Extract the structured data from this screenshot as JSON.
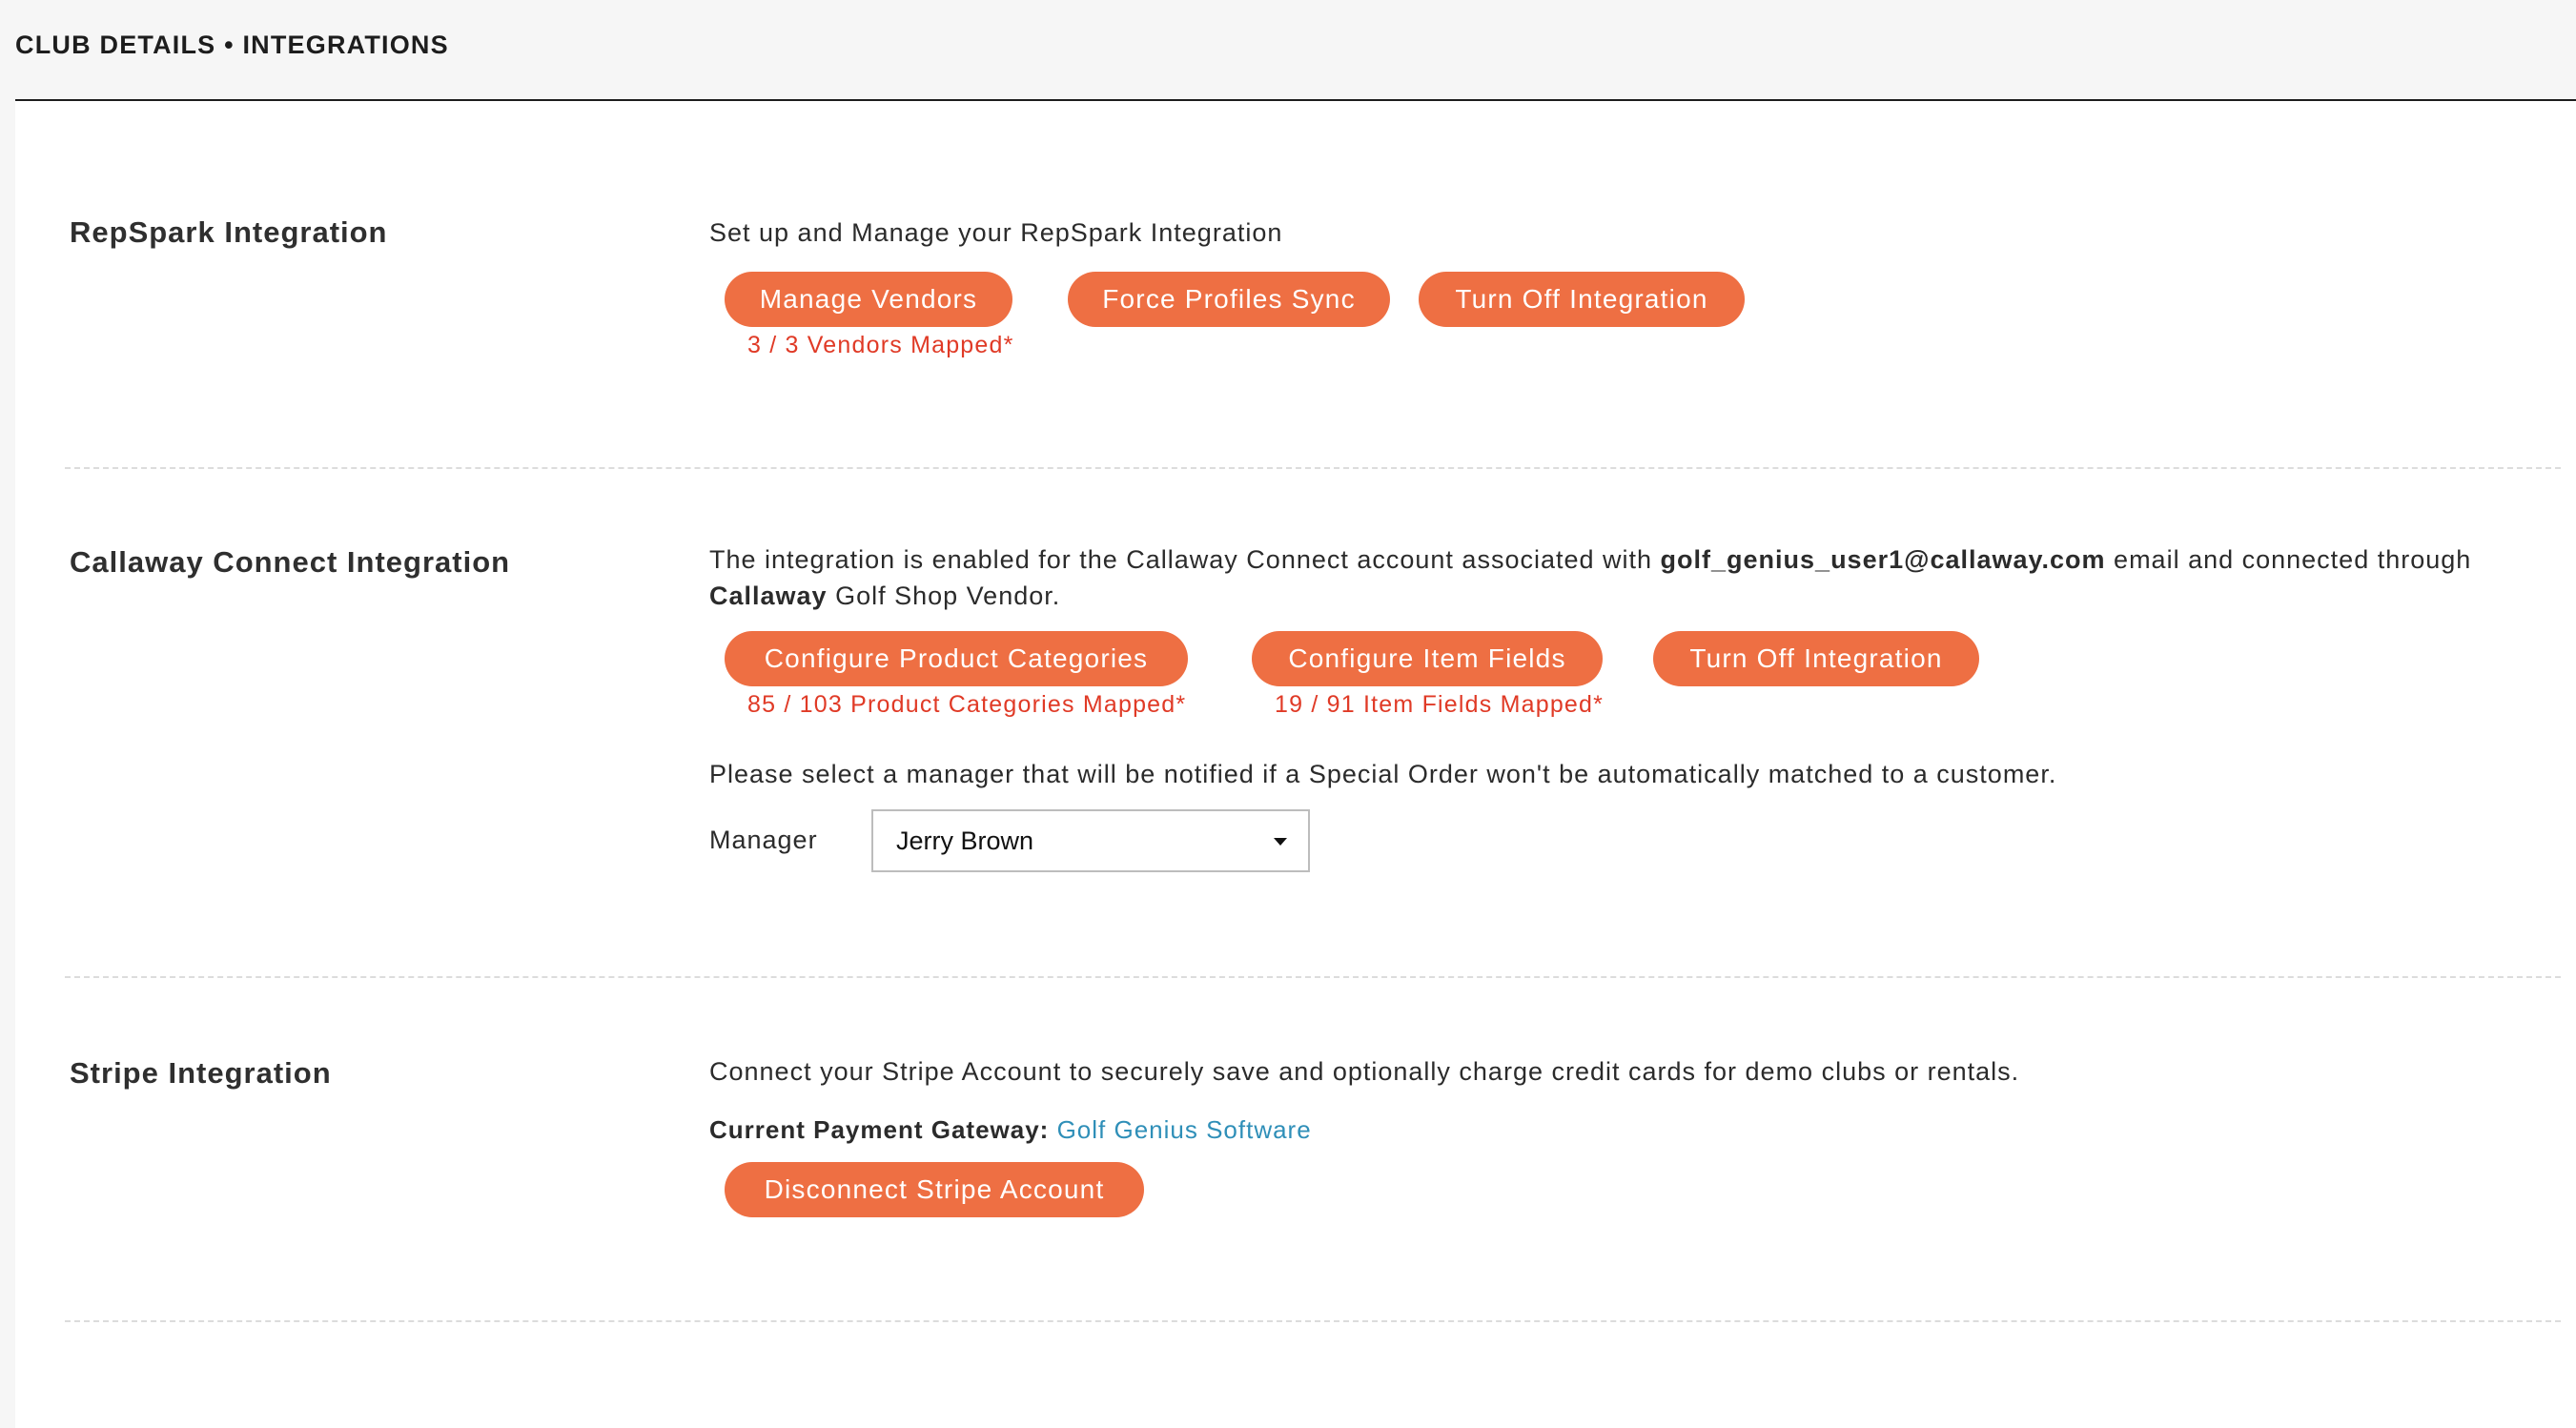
{
  "header": {
    "title": "CLUB DETAILS • INTEGRATIONS"
  },
  "repspark": {
    "title": "RepSpark Integration",
    "description": "Set up and Manage your RepSpark Integration",
    "buttons": {
      "manage_vendors": "Manage Vendors",
      "force_sync": "Force Profiles Sync",
      "turn_off": "Turn Off Integration"
    },
    "vendors_note": "3 / 3 Vendors Mapped*"
  },
  "callaway": {
    "title": "Callaway Connect Integration",
    "description_prefix": "The integration is enabled for the Callaway Connect account associated with ",
    "email": "golf_genius_user1@callaway.com",
    "description_middle": " email and connected through",
    "vendor_name": "Callaway",
    "description_suffix": " Golf Shop Vendor.",
    "buttons": {
      "configure_categories": "Configure Product Categories",
      "configure_fields": "Configure Item Fields",
      "turn_off": "Turn Off Integration"
    },
    "categories_note": "85 / 103 Product Categories Mapped*",
    "fields_note": "19 / 91 Item Fields Mapped*",
    "manager_prompt": "Please select a manager that will be notified if a Special Order won't be automatically matched to a customer.",
    "manager_label": "Manager",
    "manager_value": "Jerry Brown"
  },
  "stripe": {
    "title": "Stripe Integration",
    "description": "Connect your Stripe Account to securely save and optionally charge credit cards for demo clubs or rentals.",
    "gateway_label": "Current Payment Gateway:",
    "gateway_value": "Golf Genius Software",
    "disconnect_button": "Disconnect Stripe Account"
  },
  "colors": {
    "accent": "#ee6f43",
    "note_red": "#e03a26",
    "link_blue": "#2f8fb8"
  },
  "icons": {
    "dropdown": "caret-down-icon"
  }
}
